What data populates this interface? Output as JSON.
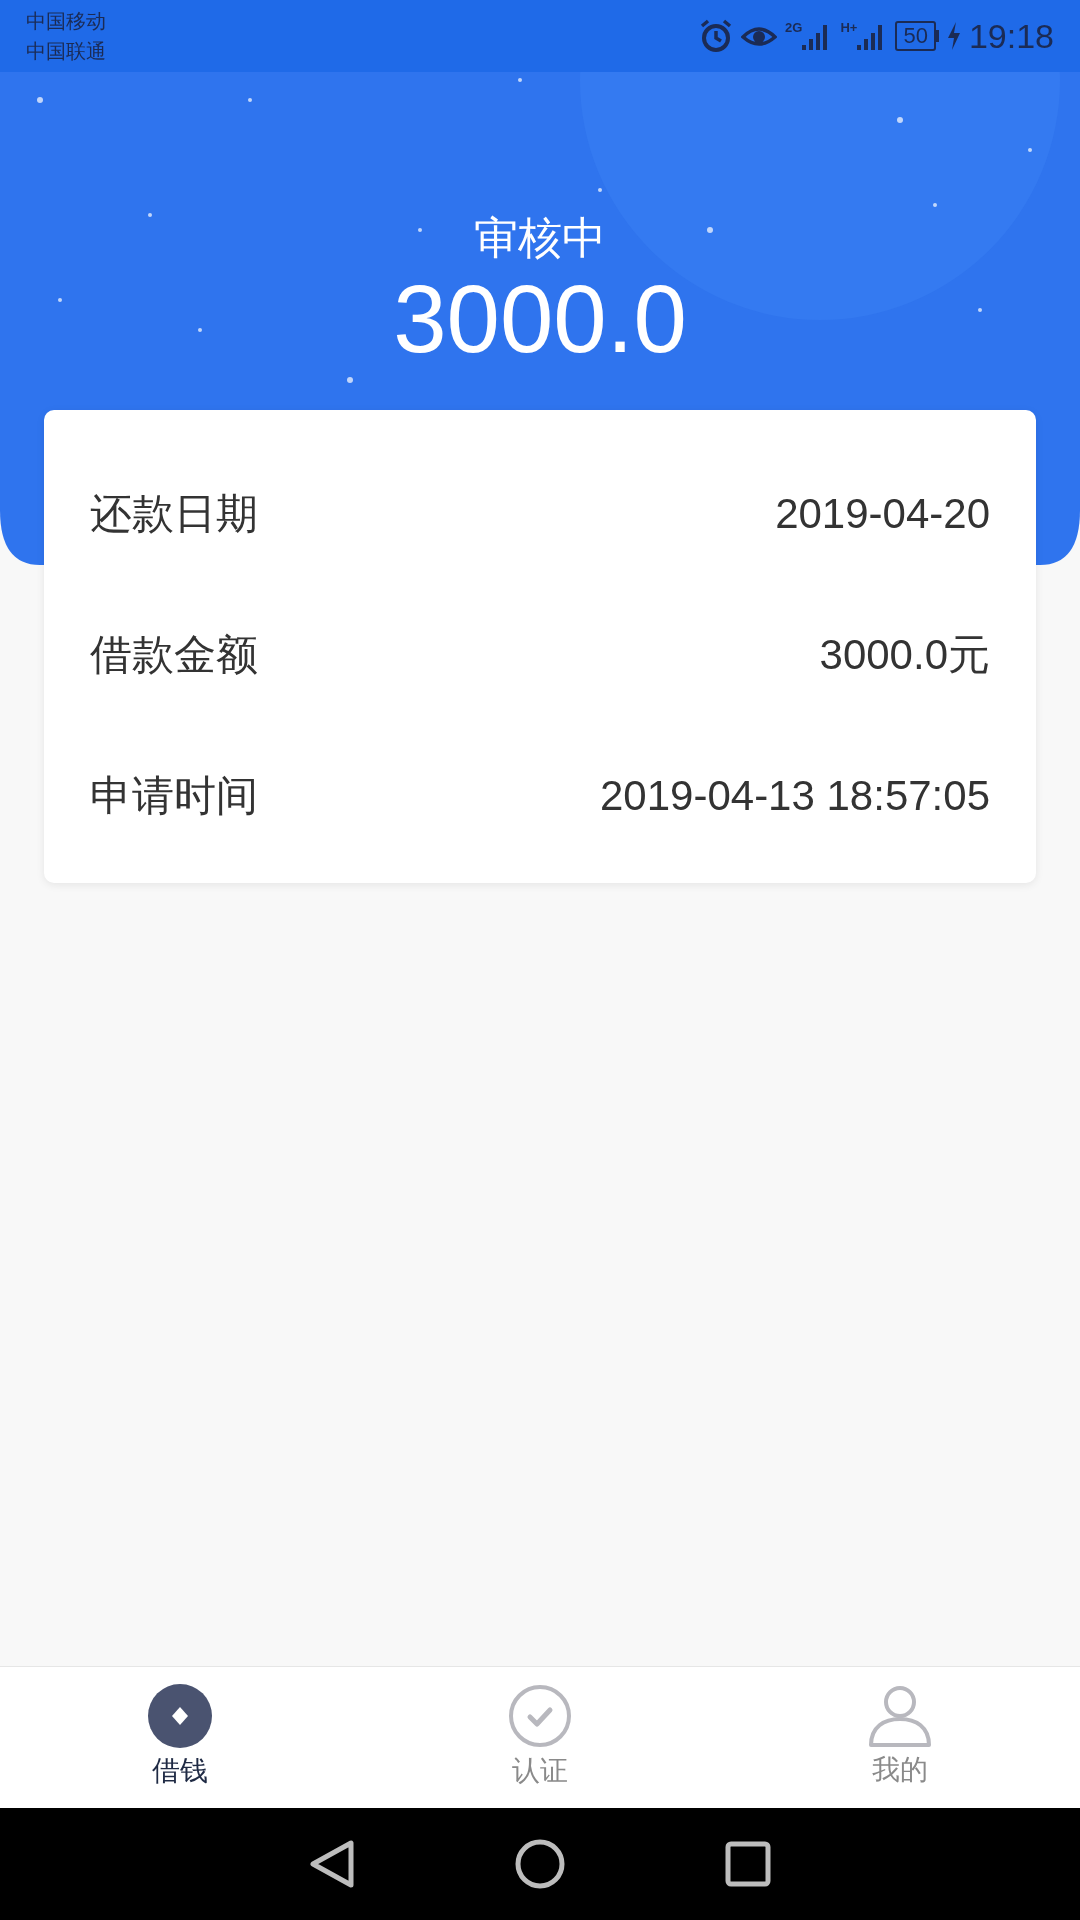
{
  "status_bar": {
    "carriers": [
      "中国移动",
      "中国联通"
    ],
    "network_1": "2G",
    "network_2": "H+",
    "battery": "50",
    "time": "19:18"
  },
  "header": {
    "status": "审核中",
    "amount": "3000.0"
  },
  "details": [
    {
      "label": "还款日期",
      "value": "2019-04-20"
    },
    {
      "label": "借款金额",
      "value": "3000.0元"
    },
    {
      "label": "申请时间",
      "value": "2019-04-13 18:57:05"
    }
  ],
  "tabs": [
    {
      "label": "借钱",
      "kind": "loan",
      "selected": true
    },
    {
      "label": "认证",
      "kind": "verify",
      "selected": false
    },
    {
      "label": "我的",
      "kind": "profile",
      "selected": false
    }
  ]
}
